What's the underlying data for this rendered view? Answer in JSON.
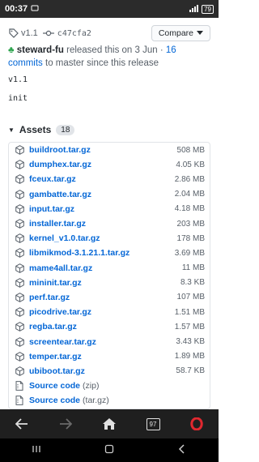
{
  "status_bar": {
    "time": "00:37",
    "battery": "79"
  },
  "release": {
    "tag": "v1.1",
    "commit": "c47cfa2",
    "compare_label": "Compare",
    "author": "steward-fu",
    "released_text": "released this on 3 Jun ·",
    "commits_link": "16 commits",
    "to_master_text": "to master since this release",
    "body_title": "v1.1",
    "body_text": "init"
  },
  "assets": {
    "label": "Assets",
    "count": "18",
    "items": [
      {
        "name": "buildroot.tar.gz",
        "size": "508 MB"
      },
      {
        "name": "dumphex.tar.gz",
        "size": "4.05 KB"
      },
      {
        "name": "fceux.tar.gz",
        "size": "2.86 MB"
      },
      {
        "name": "gambatte.tar.gz",
        "size": "2.04 MB"
      },
      {
        "name": "input.tar.gz",
        "size": "4.18 MB"
      },
      {
        "name": "installer.tar.gz",
        "size": "203 MB"
      },
      {
        "name": "kernel_v1.0.tar.gz",
        "size": "178 MB"
      },
      {
        "name": "libmikmod-3.1.21.1.tar.gz",
        "size": "3.69 MB"
      },
      {
        "name": "mame4all.tar.gz",
        "size": "11 MB"
      },
      {
        "name": "mininit.tar.gz",
        "size": "8.3 KB"
      },
      {
        "name": "perf.tar.gz",
        "size": "107 MB"
      },
      {
        "name": "picodrive.tar.gz",
        "size": "1.51 MB"
      },
      {
        "name": "regba.tar.gz",
        "size": "1.57 MB"
      },
      {
        "name": "screentear.tar.gz",
        "size": "3.43 KB"
      },
      {
        "name": "temper.tar.gz",
        "size": "1.89 MB"
      },
      {
        "name": "ubiboot.tar.gz",
        "size": "58.7 KB"
      }
    ],
    "sources": [
      {
        "name": "Source code",
        "format": "(zip)"
      },
      {
        "name": "Source code",
        "format": "(tar.gz)"
      }
    ]
  },
  "browser": {
    "tab_count": "97"
  },
  "colors": {
    "link": "#0366d6",
    "browser_bar": "#1f1f1f",
    "opera_red": "#e0282f"
  }
}
